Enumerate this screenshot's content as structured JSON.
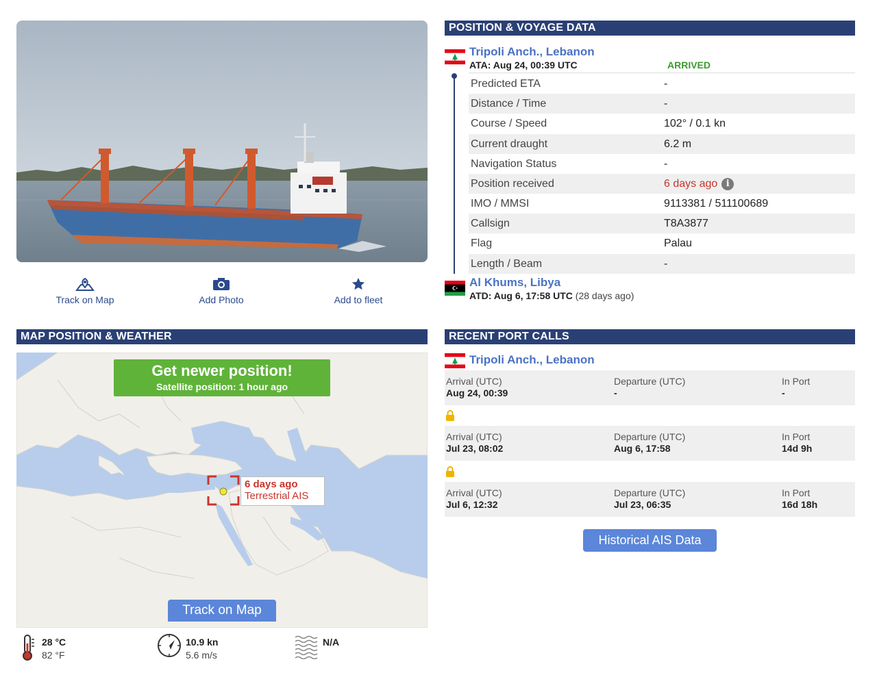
{
  "photo_actions": {
    "track_on_map": "Track on Map",
    "add_photo": "Add Photo",
    "add_to_fleet": "Add to fleet"
  },
  "voyage": {
    "header": "POSITION & VOYAGE DATA",
    "destination": {
      "port": "Tripoli Anch., Lebanon",
      "ata": "ATA: Aug 24, 00:39 UTC",
      "status": "ARRIVED"
    },
    "rows": [
      {
        "label": "Predicted ETA",
        "value": "-"
      },
      {
        "label": "Distance / Time",
        "value": "-"
      },
      {
        "label": "Course / Speed",
        "value": "102° / 0.1 kn"
      },
      {
        "label": "Current draught",
        "value": "6.2 m"
      },
      {
        "label": "Navigation Status",
        "value": "-"
      },
      {
        "label": "Position received",
        "value": "6 days ago"
      },
      {
        "label": "IMO / MMSI",
        "value": "9113381 / 511100689"
      },
      {
        "label": "Callsign",
        "value": "T8A3877"
      },
      {
        "label": "Flag",
        "value": "Palau"
      },
      {
        "label": "Length / Beam",
        "value": "-"
      }
    ],
    "departure": {
      "port": "Al Khums, Libya",
      "atd": "ATD: Aug 6, 17:58 UTC",
      "ago": "(28 days ago)"
    }
  },
  "map": {
    "header": "MAP POSITION & WEATHER",
    "get_newer_title": "Get newer position!",
    "get_newer_sub": "Satellite position: 1 hour ago",
    "position_age": "6 days ago",
    "position_source": "Terrestrial AIS",
    "track_button": "Track on Map"
  },
  "weather": {
    "temp_c": "28 °C",
    "temp_f": "82 °F",
    "wind_kn": "10.9 kn",
    "wind_ms": "5.6 m/s",
    "waves": "N/A"
  },
  "port_calls": {
    "header": "RECENT PORT CALLS",
    "port": "Tripoli Anch., Lebanon",
    "labels": {
      "arrival": "Arrival (UTC)",
      "departure": "Departure (UTC)",
      "in_port": "In Port"
    },
    "calls": [
      {
        "arrival": "Aug 24, 00:39",
        "departure": "-",
        "in_port": "-"
      },
      {
        "arrival": "Jul 23, 08:02",
        "departure": "Aug 6, 17:58",
        "in_port": "14d 9h"
      },
      {
        "arrival": "Jul 6, 12:32",
        "departure": "Jul 23, 06:35",
        "in_port": "16d 18h"
      }
    ],
    "historical_button": "Historical AIS Data"
  },
  "icons": {
    "map": "map-pin-icon",
    "camera": "camera-icon",
    "star": "star-icon",
    "info": "info-icon",
    "lock": "lock-icon",
    "thermometer": "thermometer-icon",
    "compass": "compass-icon",
    "waves": "waves-icon"
  },
  "colors": {
    "header_bg": "#2a4075",
    "link": "#4a72c4",
    "arrived": "#3b9a2e",
    "warning": "#c8352c",
    "button": "#5b86d9",
    "promo": "#5fb339"
  }
}
